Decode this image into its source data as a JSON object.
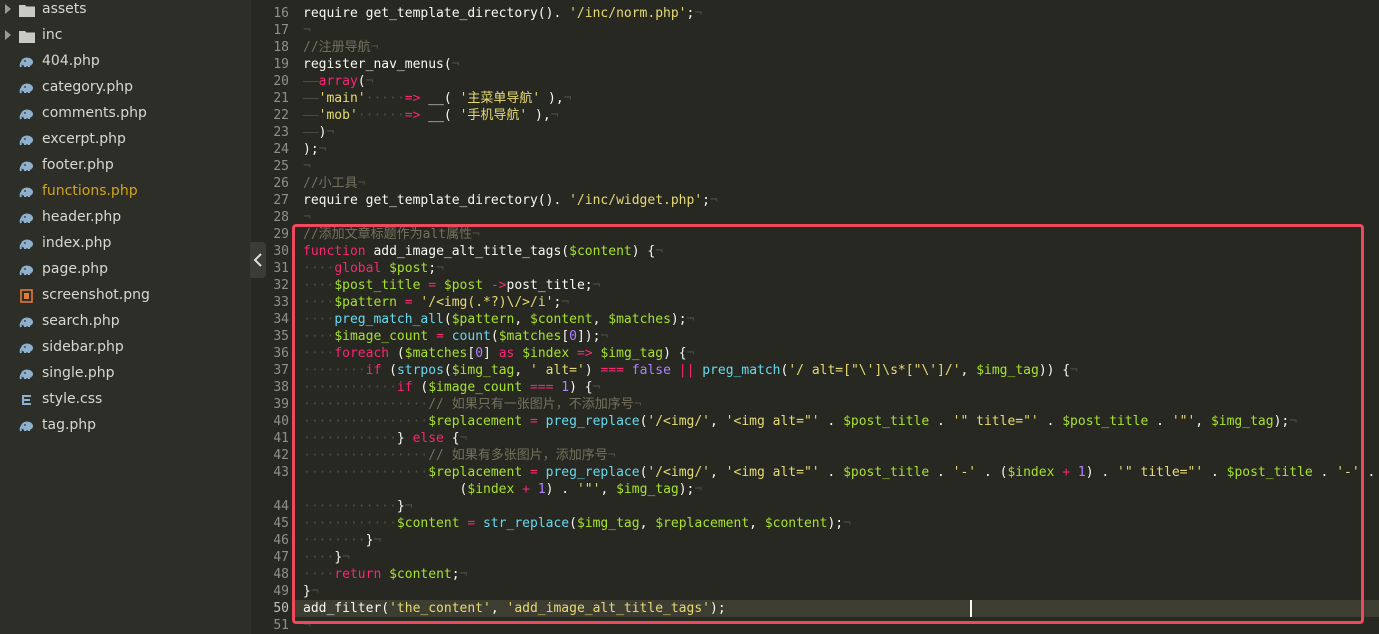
{
  "sidebar": {
    "items": [
      {
        "label": "assets",
        "type": "folder",
        "icon": "folder-icon"
      },
      {
        "label": "inc",
        "type": "folder",
        "icon": "folder-icon"
      },
      {
        "label": "404.php",
        "type": "php",
        "icon": "php-elephant-icon"
      },
      {
        "label": "category.php",
        "type": "php",
        "icon": "php-elephant-icon"
      },
      {
        "label": "comments.php",
        "type": "php",
        "icon": "php-elephant-icon"
      },
      {
        "label": "excerpt.php",
        "type": "php",
        "icon": "php-elephant-icon"
      },
      {
        "label": "footer.php",
        "type": "php",
        "icon": "php-elephant-icon"
      },
      {
        "label": "functions.php",
        "type": "php",
        "icon": "php-elephant-icon",
        "active": true
      },
      {
        "label": "header.php",
        "type": "php",
        "icon": "php-elephant-icon"
      },
      {
        "label": "index.php",
        "type": "php",
        "icon": "php-elephant-icon"
      },
      {
        "label": "page.php",
        "type": "php",
        "icon": "php-elephant-icon"
      },
      {
        "label": "screenshot.png",
        "type": "image",
        "icon": "image-file-icon"
      },
      {
        "label": "search.php",
        "type": "php",
        "icon": "php-elephant-icon"
      },
      {
        "label": "sidebar.php",
        "type": "php",
        "icon": "php-elephant-icon"
      },
      {
        "label": "single.php",
        "type": "php",
        "icon": "php-elephant-icon"
      },
      {
        "label": "style.css",
        "type": "css",
        "icon": "css-file-icon"
      },
      {
        "label": "tag.php",
        "type": "php",
        "icon": "php-elephant-icon"
      }
    ]
  },
  "editor": {
    "line_numbers": [
      "16",
      "17",
      "18",
      "19",
      "20",
      "21",
      "22",
      "23",
      "24",
      "25",
      "26",
      "27",
      "28",
      "29",
      "30",
      "31",
      "32",
      "33",
      "34",
      "35",
      "36",
      "37",
      "38",
      "39",
      "40",
      "41",
      "42",
      "43",
      "",
      "44",
      "45",
      "46",
      "47",
      "48",
      "49",
      "50",
      "51"
    ],
    "lines": [
      [
        [
          "p",
          "require get_template_directory(). "
        ],
        [
          "s",
          "'/inc/norm.php'"
        ],
        [
          "p",
          ";"
        ],
        [
          "w",
          "¬"
        ]
      ],
      [
        [
          "w",
          "¬"
        ]
      ],
      [
        [
          "c",
          "//注册导航"
        ],
        [
          "w",
          "¬"
        ]
      ],
      [
        [
          "p",
          "register_nav_menus("
        ],
        [
          "w",
          "¬"
        ]
      ],
      [
        [
          "w",
          "——"
        ],
        [
          "k",
          "array"
        ],
        [
          "p",
          "("
        ],
        [
          "w",
          "¬"
        ]
      ],
      [
        [
          "w",
          "——"
        ],
        [
          "s",
          "'main'"
        ],
        [
          "w",
          "·····"
        ],
        [
          "k",
          "=>"
        ],
        [
          "p",
          " __( "
        ],
        [
          "s",
          "'主菜单导航'"
        ],
        [
          "p",
          " ),"
        ],
        [
          "w",
          "¬"
        ]
      ],
      [
        [
          "w",
          "——"
        ],
        [
          "s",
          "'mob'"
        ],
        [
          "w",
          "······"
        ],
        [
          "k",
          "=>"
        ],
        [
          "p",
          " __( "
        ],
        [
          "s",
          "'手机导航'"
        ],
        [
          "p",
          " ),"
        ],
        [
          "w",
          "¬"
        ]
      ],
      [
        [
          "w",
          "——"
        ],
        [
          "p",
          ")"
        ],
        [
          "w",
          "¬"
        ]
      ],
      [
        [
          "p",
          ");"
        ],
        [
          "w",
          "¬"
        ]
      ],
      [
        [
          "w",
          "¬"
        ]
      ],
      [
        [
          "c",
          "//小工具"
        ],
        [
          "w",
          "¬"
        ]
      ],
      [
        [
          "p",
          "require get_template_directory(). "
        ],
        [
          "s",
          "'/inc/widget.php'"
        ],
        [
          "p",
          ";"
        ],
        [
          "w",
          "¬"
        ]
      ],
      [
        [
          "w",
          "¬"
        ]
      ],
      [
        [
          "c",
          "//添加文章标题作为alt属性"
        ],
        [
          "w",
          "¬"
        ]
      ],
      [
        [
          "k",
          "function"
        ],
        [
          "p",
          " add_image_alt_title_tags("
        ],
        [
          "v",
          "$content"
        ],
        [
          "p",
          ") {"
        ],
        [
          "w",
          "¬"
        ]
      ],
      [
        [
          "w",
          "····"
        ],
        [
          "k",
          "global"
        ],
        [
          "p",
          " "
        ],
        [
          "v",
          "$post"
        ],
        [
          "p",
          ";"
        ],
        [
          "w",
          "¬"
        ]
      ],
      [
        [
          "w",
          "····"
        ],
        [
          "v",
          "$post_title"
        ],
        [
          "p",
          " "
        ],
        [
          "k",
          "="
        ],
        [
          "p",
          " "
        ],
        [
          "v",
          "$post"
        ],
        [
          "p",
          " "
        ],
        [
          "k",
          "->"
        ],
        [
          "p",
          "post_title;"
        ],
        [
          "w",
          "¬"
        ]
      ],
      [
        [
          "w",
          "····"
        ],
        [
          "v",
          "$pattern"
        ],
        [
          "p",
          " "
        ],
        [
          "k",
          "="
        ],
        [
          "p",
          " "
        ],
        [
          "s",
          "'/<img(.*?)\\/>/i'"
        ],
        [
          "p",
          ";"
        ],
        [
          "w",
          "¬"
        ]
      ],
      [
        [
          "w",
          "····"
        ],
        [
          "f",
          "preg_match_all"
        ],
        [
          "p",
          "("
        ],
        [
          "v",
          "$pattern"
        ],
        [
          "p",
          ", "
        ],
        [
          "v",
          "$content"
        ],
        [
          "p",
          ", "
        ],
        [
          "v",
          "$matches"
        ],
        [
          "p",
          ");"
        ],
        [
          "w",
          "¬"
        ]
      ],
      [
        [
          "w",
          "····"
        ],
        [
          "v",
          "$image_count"
        ],
        [
          "p",
          " "
        ],
        [
          "k",
          "="
        ],
        [
          "p",
          " "
        ],
        [
          "f",
          "count"
        ],
        [
          "p",
          "("
        ],
        [
          "v",
          "$matches"
        ],
        [
          "p",
          "["
        ],
        [
          "n",
          "0"
        ],
        [
          "p",
          "]);"
        ],
        [
          "w",
          "¬"
        ]
      ],
      [
        [
          "w",
          "····"
        ],
        [
          "k",
          "foreach"
        ],
        [
          "p",
          " ("
        ],
        [
          "v",
          "$matches"
        ],
        [
          "p",
          "["
        ],
        [
          "n",
          "0"
        ],
        [
          "p",
          "] "
        ],
        [
          "k",
          "as"
        ],
        [
          "p",
          " "
        ],
        [
          "v",
          "$index"
        ],
        [
          "p",
          " "
        ],
        [
          "k",
          "=>"
        ],
        [
          "p",
          " "
        ],
        [
          "v",
          "$img_tag"
        ],
        [
          "p",
          ") {"
        ],
        [
          "w",
          "¬"
        ]
      ],
      [
        [
          "w",
          "········"
        ],
        [
          "k",
          "if"
        ],
        [
          "p",
          " ("
        ],
        [
          "f",
          "strpos"
        ],
        [
          "p",
          "("
        ],
        [
          "v",
          "$img_tag"
        ],
        [
          "p",
          ", "
        ],
        [
          "s",
          "' alt='"
        ],
        [
          "p",
          ") "
        ],
        [
          "k",
          "==="
        ],
        [
          "p",
          " "
        ],
        [
          "n",
          "false"
        ],
        [
          "p",
          " "
        ],
        [
          "k",
          "||"
        ],
        [
          "p",
          " "
        ],
        [
          "f",
          "preg_match"
        ],
        [
          "p",
          "("
        ],
        [
          "s",
          "'/ alt=[\"\\']\\s*[\"\\']/'"
        ],
        [
          "p",
          ", "
        ],
        [
          "v",
          "$img_tag"
        ],
        [
          "p",
          ")) {"
        ],
        [
          "w",
          "¬"
        ]
      ],
      [
        [
          "w",
          "············"
        ],
        [
          "k",
          "if"
        ],
        [
          "p",
          " ("
        ],
        [
          "v",
          "$image_count"
        ],
        [
          "p",
          " "
        ],
        [
          "k",
          "==="
        ],
        [
          "p",
          " "
        ],
        [
          "n",
          "1"
        ],
        [
          "p",
          ") {"
        ],
        [
          "w",
          "¬"
        ]
      ],
      [
        [
          "w",
          "················"
        ],
        [
          "c",
          "// 如果只有一张图片，不添加序号"
        ],
        [
          "w",
          "¬"
        ]
      ],
      [
        [
          "w",
          "················"
        ],
        [
          "v",
          "$replacement"
        ],
        [
          "p",
          " "
        ],
        [
          "k",
          "="
        ],
        [
          "p",
          " "
        ],
        [
          "f",
          "preg_replace"
        ],
        [
          "p",
          "("
        ],
        [
          "s",
          "'/<img/'"
        ],
        [
          "p",
          ", "
        ],
        [
          "s",
          "'<img alt=\"'"
        ],
        [
          "p",
          " . "
        ],
        [
          "v",
          "$post_title"
        ],
        [
          "p",
          " . "
        ],
        [
          "s",
          "'\" title=\"'"
        ],
        [
          "p",
          " . "
        ],
        [
          "v",
          "$post_title"
        ],
        [
          "p",
          " . "
        ],
        [
          "s",
          "'\"'"
        ],
        [
          "p",
          ", "
        ],
        [
          "v",
          "$img_tag"
        ],
        [
          "p",
          ");"
        ],
        [
          "w",
          "¬"
        ]
      ],
      [
        [
          "w",
          "············"
        ],
        [
          "p",
          "} "
        ],
        [
          "k",
          "else"
        ],
        [
          "p",
          " {"
        ],
        [
          "w",
          "¬"
        ]
      ],
      [
        [
          "w",
          "················"
        ],
        [
          "c",
          "// 如果有多张图片，添加序号"
        ],
        [
          "w",
          "¬"
        ]
      ],
      [
        [
          "w",
          "················"
        ],
        [
          "v",
          "$replacement"
        ],
        [
          "p",
          " "
        ],
        [
          "k",
          "="
        ],
        [
          "p",
          " "
        ],
        [
          "f",
          "preg_replace"
        ],
        [
          "p",
          "("
        ],
        [
          "s",
          "'/<img/'"
        ],
        [
          "p",
          ", "
        ],
        [
          "s",
          "'<img alt=\"'"
        ],
        [
          "p",
          " . "
        ],
        [
          "v",
          "$post_title"
        ],
        [
          "p",
          " . "
        ],
        [
          "s",
          "'-'"
        ],
        [
          "p",
          " . ("
        ],
        [
          "v",
          "$index"
        ],
        [
          "p",
          " "
        ],
        [
          "k",
          "+"
        ],
        [
          "p",
          " "
        ],
        [
          "n",
          "1"
        ],
        [
          "p",
          ") . "
        ],
        [
          "s",
          "'\" title=\"'"
        ],
        [
          "p",
          " . "
        ],
        [
          "v",
          "$post_title"
        ],
        [
          "p",
          " . "
        ],
        [
          "s",
          "'-'"
        ],
        [
          "p",
          " ."
        ]
      ],
      [
        [
          "p",
          "                    ("
        ],
        [
          "v",
          "$index"
        ],
        [
          "p",
          " "
        ],
        [
          "k",
          "+"
        ],
        [
          "p",
          " "
        ],
        [
          "n",
          "1"
        ],
        [
          "p",
          ") . "
        ],
        [
          "s",
          "'\"'"
        ],
        [
          "p",
          ", "
        ],
        [
          "v",
          "$img_tag"
        ],
        [
          "p",
          ");"
        ],
        [
          "w",
          "¬"
        ]
      ],
      [
        [
          "w",
          "············"
        ],
        [
          "p",
          "}"
        ],
        [
          "w",
          "¬"
        ]
      ],
      [
        [
          "w",
          "············"
        ],
        [
          "v",
          "$content"
        ],
        [
          "p",
          " "
        ],
        [
          "k",
          "="
        ],
        [
          "p",
          " "
        ],
        [
          "f",
          "str_replace"
        ],
        [
          "p",
          "("
        ],
        [
          "v",
          "$img_tag"
        ],
        [
          "p",
          ", "
        ],
        [
          "v",
          "$replacement"
        ],
        [
          "p",
          ", "
        ],
        [
          "v",
          "$content"
        ],
        [
          "p",
          ");"
        ],
        [
          "w",
          "¬"
        ]
      ],
      [
        [
          "w",
          "········"
        ],
        [
          "p",
          "}"
        ],
        [
          "w",
          "¬"
        ]
      ],
      [
        [
          "w",
          "····"
        ],
        [
          "p",
          "}"
        ],
        [
          "w",
          "¬"
        ]
      ],
      [
        [
          "w",
          "····"
        ],
        [
          "k",
          "return"
        ],
        [
          "p",
          " "
        ],
        [
          "v",
          "$content"
        ],
        [
          "p",
          ";"
        ],
        [
          "w",
          "¬"
        ]
      ],
      [
        [
          "p",
          "}"
        ],
        [
          "w",
          "¬"
        ]
      ],
      [
        [
          "p",
          "add_filter("
        ],
        [
          "s",
          "'the_content'"
        ],
        [
          "p",
          ", "
        ],
        [
          "s",
          "'add_image_alt_title_tags'"
        ],
        [
          "p",
          ");"
        ]
      ],
      [
        [
          "w",
          "¬"
        ]
      ]
    ]
  }
}
